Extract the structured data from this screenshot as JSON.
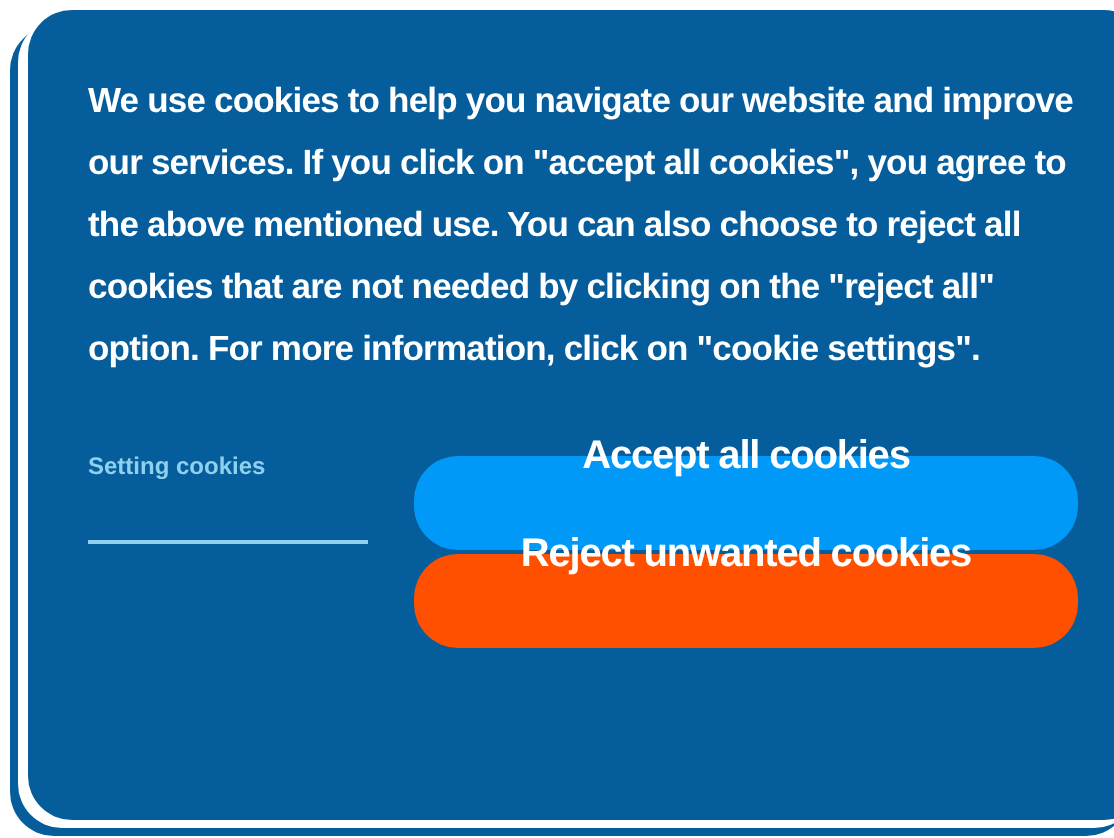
{
  "message": "We use cookies to help you navigate our website and improve our services. If you click on \"accept all cookies\", you agree to the above mentioned use. You can also choose to reject all cookies that are not needed by clicking on the \"reject all\" option. For more information, click on \"cookie settings\".",
  "settings_link": "Setting cookies",
  "buttons": [
    {
      "label": "Accept all cookies",
      "kind": "accept"
    },
    {
      "label": "Reject unwanted cookies",
      "kind": "reject"
    }
  ]
}
